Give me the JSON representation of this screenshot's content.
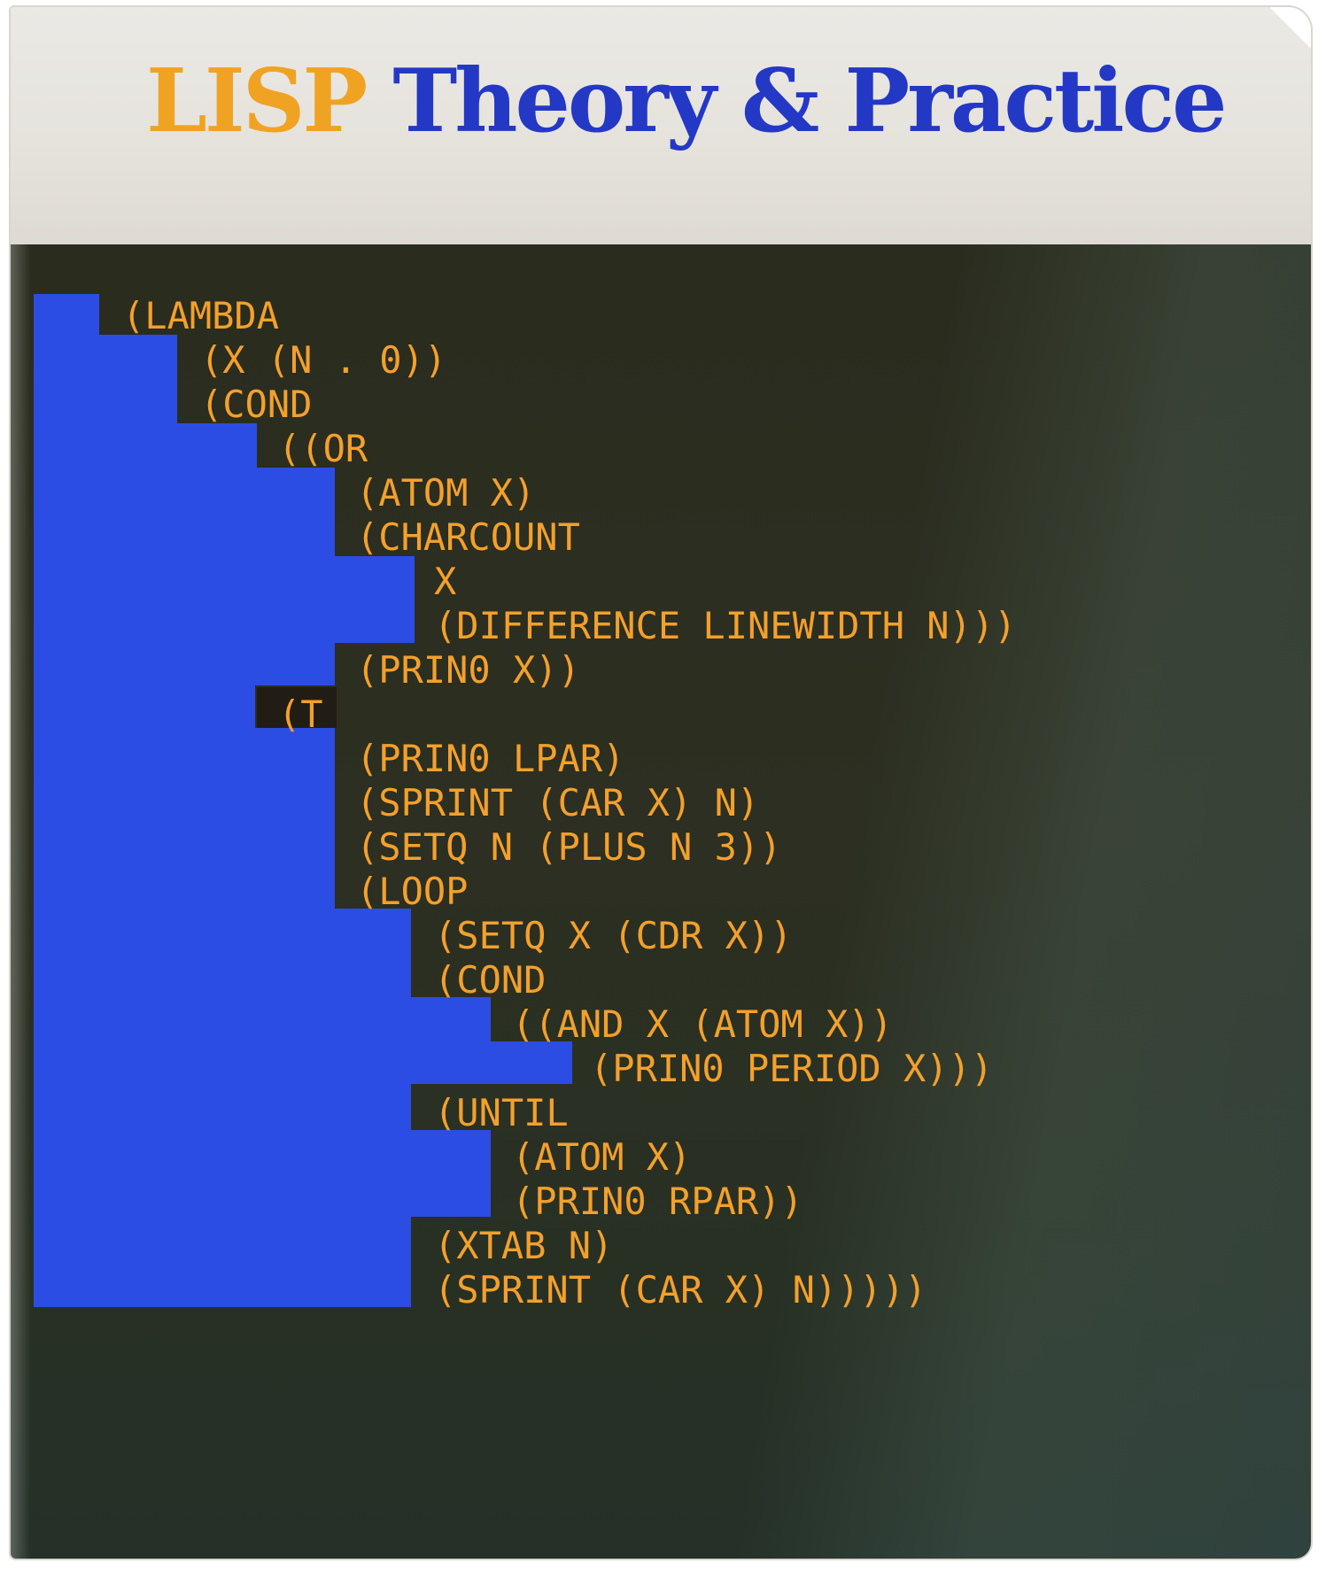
{
  "cover": {
    "title_part1": "LISP",
    "title_part2": "Theory & Practice",
    "colors": {
      "title_part1": "#f0a323",
      "title_part2": "#2438c6",
      "code": "#f3a02c",
      "stair": "#2c4de3",
      "panel": "#2b2d20"
    },
    "code_lines": [
      "(LAMBDA",
      "(X (N . 0))",
      "(COND",
      "((OR",
      "(ATOM X)",
      "(CHARCOUNT",
      "X",
      "(DIFFERENCE LINEWIDTH N)))",
      "(PRIN0 X))",
      "(T",
      "(PRIN0 LPAR)",
      "(SPRINT (CAR X) N)",
      "(SETQ N (PLUS N 3))",
      "(LOOP",
      "(SETQ X (CDR X))",
      "(COND",
      "((AND X (ATOM X))",
      "(PRIN0 PERIOD X)))",
      "(UNTIL",
      "(ATOM X)",
      "(PRIN0 RPAR))",
      "(XTAB N)",
      "(SPRINT (CAR X) N)))))"
    ]
  }
}
